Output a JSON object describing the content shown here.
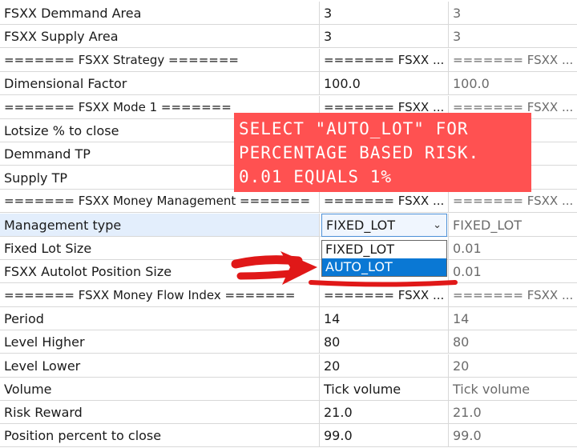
{
  "rows": [
    {
      "label": "FSXX Demmand Area",
      "value": "3",
      "default": "3"
    },
    {
      "label": "FSXX Supply Area",
      "value": "3",
      "default": "3"
    },
    {
      "label": "======= FSXX Strategy =======",
      "value": "======= FSXX ...",
      "default": "======= FSXX ..."
    },
    {
      "label": "Dimensional Factor",
      "value": "100.0",
      "default": "100.0"
    },
    {
      "label": "======= FSXX Mode 1 =======",
      "value": "======= FSXX ...",
      "default": "======= FSXX ..."
    },
    {
      "label": "Lotsize % to close",
      "value": "",
      "default": ""
    },
    {
      "label": "Demmand TP",
      "value": "",
      "default": ""
    },
    {
      "label": "Supply TP",
      "value": "",
      "default": ""
    },
    {
      "label": "======= FSXX Money Management =======",
      "value": "======= FSXX ...",
      "default": "======= FSXX ..."
    },
    {
      "label": "Management type",
      "value": "",
      "default": "FIXED_LOT"
    },
    {
      "label": "Fixed Lot Size",
      "value": "",
      "default": "0.01"
    },
    {
      "label": "FSXX Autolot Position Size",
      "value": "",
      "default": "0.01"
    },
    {
      "label": "======= FSXX Money Flow Index =======",
      "value": "======= FSXX ...",
      "default": "======= FSXX ..."
    },
    {
      "label": "Period",
      "value": "14",
      "default": "14"
    },
    {
      "label": "Level Higher",
      "value": "80",
      "default": "80"
    },
    {
      "label": "Level Lower",
      "value": "20",
      "default": "20"
    },
    {
      "label": "Volume",
      "value": "Tick volume",
      "default": "Tick volume"
    },
    {
      "label": "Risk Reward",
      "value": "21.0",
      "default": "21.0"
    },
    {
      "label": "Position percent to close",
      "value": "99.0",
      "default": "99.0"
    }
  ],
  "management_type": {
    "selected": "FIXED_LOT",
    "arrow_icon": "chevron-down-icon",
    "options": [
      "FIXED_LOT",
      "AUTO_LOT"
    ],
    "highlighted_option": "AUTO_LOT"
  },
  "annotation": {
    "lines": [
      "SELECT \"AUTO_LOT\" FOR",
      "PERCENTAGE BASED RISK.",
      "0.01 EQUALS 1%"
    ],
    "background_color": "#ff5151",
    "arrow_color": "#e01818",
    "arrow_icon": "red-arrow-icon"
  },
  "colors": {
    "selection_blue": "#0a78d4",
    "row_highlight": "#e3eefc",
    "grid_line": "#d8d8d8"
  }
}
